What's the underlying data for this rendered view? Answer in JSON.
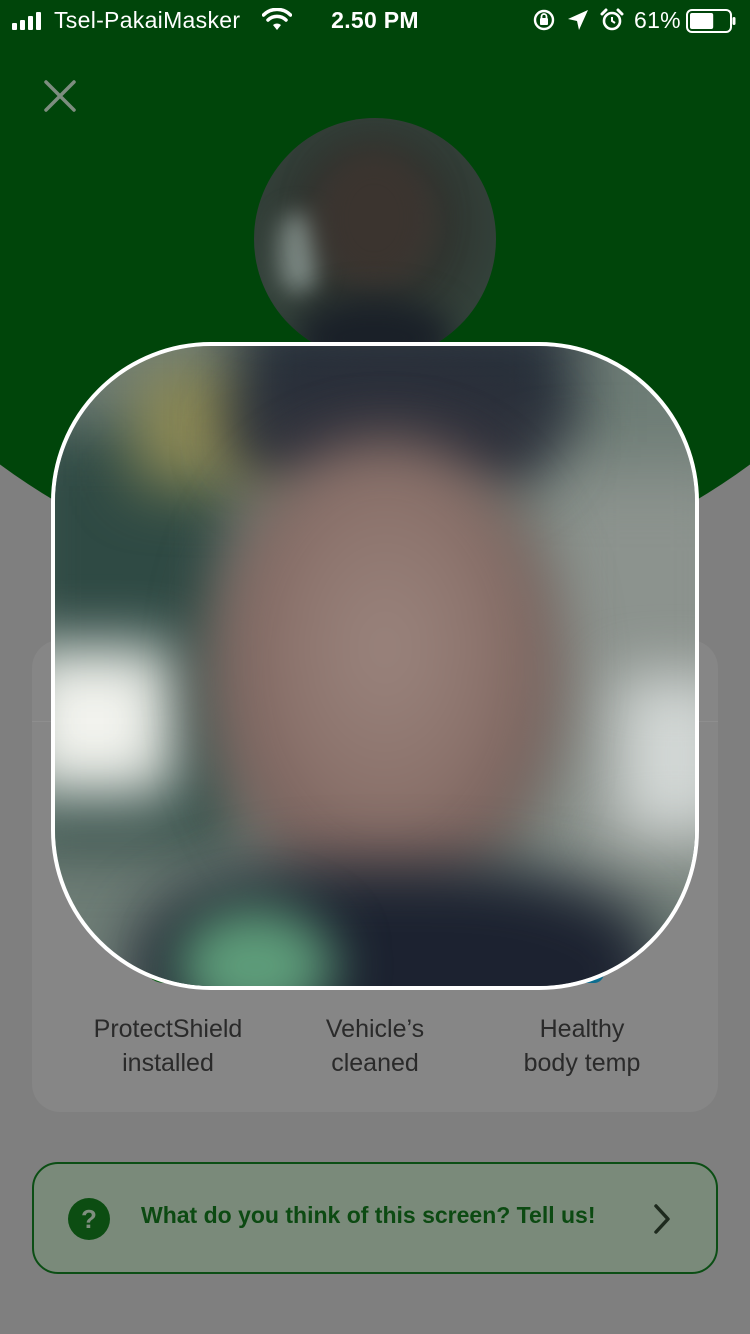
{
  "status_bar": {
    "carrier": "Tsel-PakaiMasker",
    "time": "2.50 PM",
    "battery_percent": "61%",
    "battery_level": 0.61,
    "icons": [
      "signal-bars-icon",
      "wifi-icon",
      "rotation-lock-icon",
      "location-arrow-icon",
      "alarm-clock-icon",
      "battery-icon"
    ]
  },
  "header": {
    "close_icon": "close-icon"
  },
  "features": [
    {
      "label": "ProtectShield\ninstalled",
      "icon": "shield-icon",
      "color": "#0c5f16"
    },
    {
      "label": "Vehicle’s\ncleaned",
      "icon": "car-clean-icon"
    },
    {
      "label": "Healthy\nbody temp",
      "icon": "thermometer-icon",
      "color": "#0d6d8f"
    }
  ],
  "feedback": {
    "text": "What do you think of this screen? Tell us!",
    "icon_glyph": "?",
    "icon": "question-icon",
    "chevron": "chevron-right-icon"
  },
  "colors": {
    "brand_green": "#00450a",
    "overlay_gray": "#7f7f7f",
    "feedback_text": "#0c4a12"
  }
}
